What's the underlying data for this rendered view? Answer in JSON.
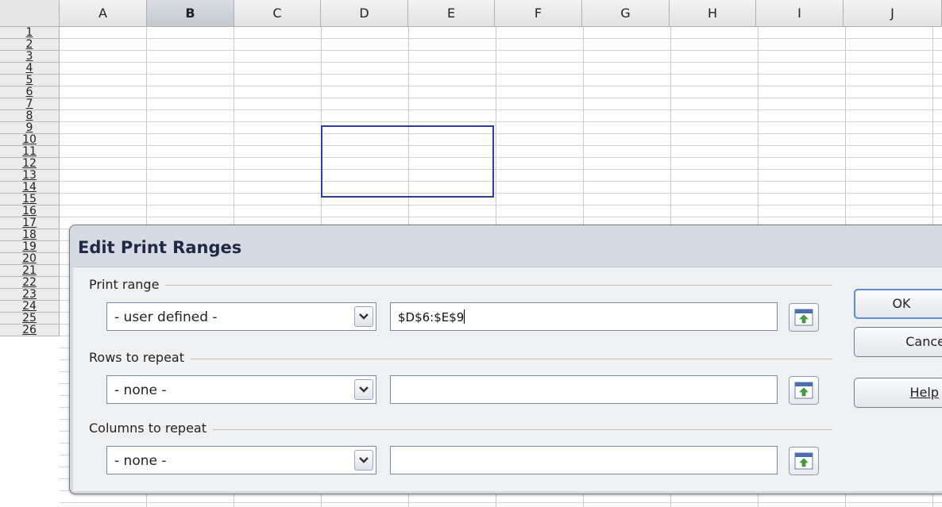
{
  "spreadsheet": {
    "columns": [
      "A",
      "B",
      "C",
      "D",
      "E",
      "F",
      "G",
      "H",
      "I",
      "J"
    ],
    "active_column": "B",
    "rows": [
      "1",
      "2",
      "3",
      "4",
      "5",
      "6",
      "7",
      "8",
      "9",
      "10",
      "11",
      "12",
      "13",
      "14",
      "15",
      "16",
      "17",
      "18",
      "19",
      "20",
      "21",
      "22",
      "23",
      "24",
      "25",
      "26"
    ],
    "selection_range": "D6:E9"
  },
  "dialog": {
    "title": "Edit Print Ranges",
    "print_range": {
      "label": "Print range",
      "selected_option": "- user defined -",
      "value": "$D$6:$E$9"
    },
    "rows_to_repeat": {
      "label": "Rows to repeat",
      "selected_option": "- none -",
      "value": ""
    },
    "columns_to_repeat": {
      "label": "Columns to repeat",
      "selected_option": "- none -",
      "value": ""
    },
    "buttons": {
      "ok": "OK",
      "cancel": "Cance",
      "help": "Help"
    }
  },
  "icons": {
    "dropdown": "chevron-down-icon",
    "shrink": "shrink-dialog-icon"
  },
  "colors": {
    "selection_border": "#2a3fa0",
    "dialog_title": "#1e2a44",
    "default_button_border": "#5d8fcf"
  }
}
